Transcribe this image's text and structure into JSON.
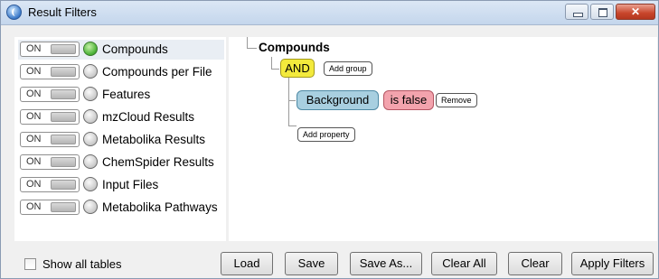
{
  "window": {
    "title": "Result Filters"
  },
  "filters": [
    {
      "toggle": "ON",
      "label": "Compounds",
      "active": true
    },
    {
      "toggle": "ON",
      "label": "Compounds per File",
      "active": false
    },
    {
      "toggle": "ON",
      "label": "Features",
      "active": false
    },
    {
      "toggle": "ON",
      "label": "mzCloud Results",
      "active": false
    },
    {
      "toggle": "ON",
      "label": "Metabolika Results",
      "active": false
    },
    {
      "toggle": "ON",
      "label": "ChemSpider Results",
      "active": false
    },
    {
      "toggle": "ON",
      "label": "Input Files",
      "active": false
    },
    {
      "toggle": "ON",
      "label": "Metabolika Pathways",
      "active": false
    }
  ],
  "editor": {
    "root": "Compounds",
    "operator": "AND",
    "add_group": "Add group",
    "property": "Background",
    "condition": "is false",
    "remove": "Remove",
    "add_property": "Add property"
  },
  "footer": {
    "show_all_tables": "Show all tables",
    "load": "Load",
    "save": "Save",
    "save_as": "Save As...",
    "clear_all": "Clear All",
    "clear": "Clear",
    "apply_filters": "Apply Filters"
  },
  "colors": {
    "active_dot": "#4fb53a",
    "operator": "#f3ea3c",
    "property": "#a8cfe0",
    "condition": "#f3a3ad"
  }
}
